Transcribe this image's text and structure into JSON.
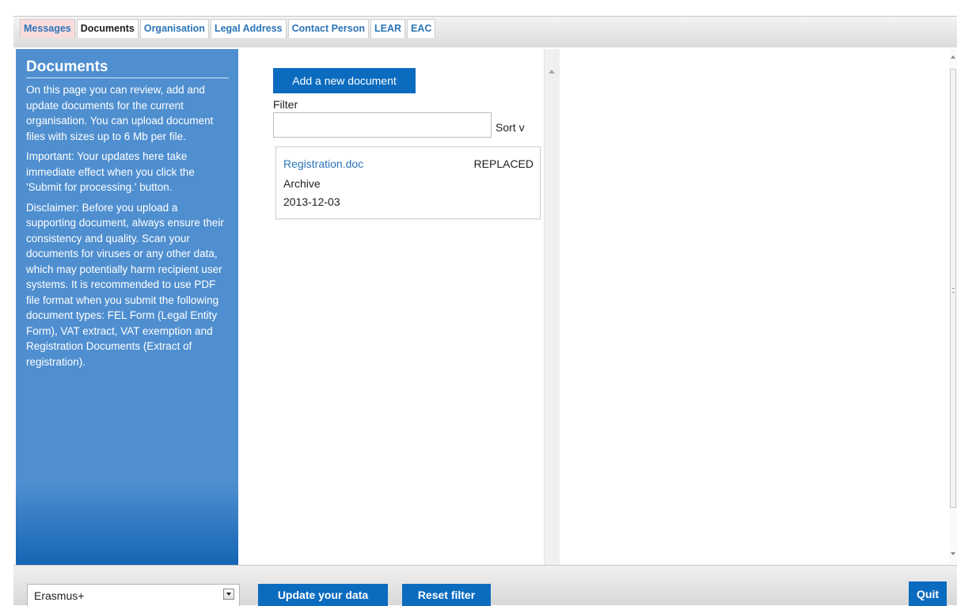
{
  "tabs": [
    {
      "label": "Messages"
    },
    {
      "label": "Documents"
    },
    {
      "label": "Organisation"
    },
    {
      "label": "Legal Address"
    },
    {
      "label": "Contact Person"
    },
    {
      "label": "LEAR"
    },
    {
      "label": "EAC"
    }
  ],
  "active_tab": "Documents",
  "info_panel": {
    "title": "Documents",
    "paragraphs": [
      "On this page you can review, add and update documents for the current organisation. You can upload document files with sizes up to 6 Mb per file.",
      "Important: Your updates here take immediate effect when you click the 'Submit for processing.' button.",
      "Disclaimer: Before you upload a supporting document, always ensure their consistency and quality. Scan your documents for viruses or any other data, which may potentially harm recipient user systems. It is recommended to use PDF file format when you submit the following document types: FEL Form (Legal Entity Form), VAT extract, VAT exemption and Registration Documents (Extract of registration)."
    ]
  },
  "documents": {
    "add_button_label": "Add a new document",
    "filter_label": "Filter",
    "filter_value": "",
    "sort_label": "Sort v",
    "items": [
      {
        "name": "Registration.doc",
        "status": "REPLACED",
        "type": "Archive",
        "date": "2013-12-03"
      }
    ]
  },
  "bottom_bar": {
    "program_selected": "Erasmus+",
    "update_label": "Update your data",
    "reset_label": "Reset filter",
    "quit_label": "Quit"
  },
  "colors": {
    "accent_blue": "#0b6bbf",
    "panel_blue": "#4f8fd0",
    "link_blue": "#2b74b8",
    "messages_tab_bg": "#fbdcdc"
  }
}
